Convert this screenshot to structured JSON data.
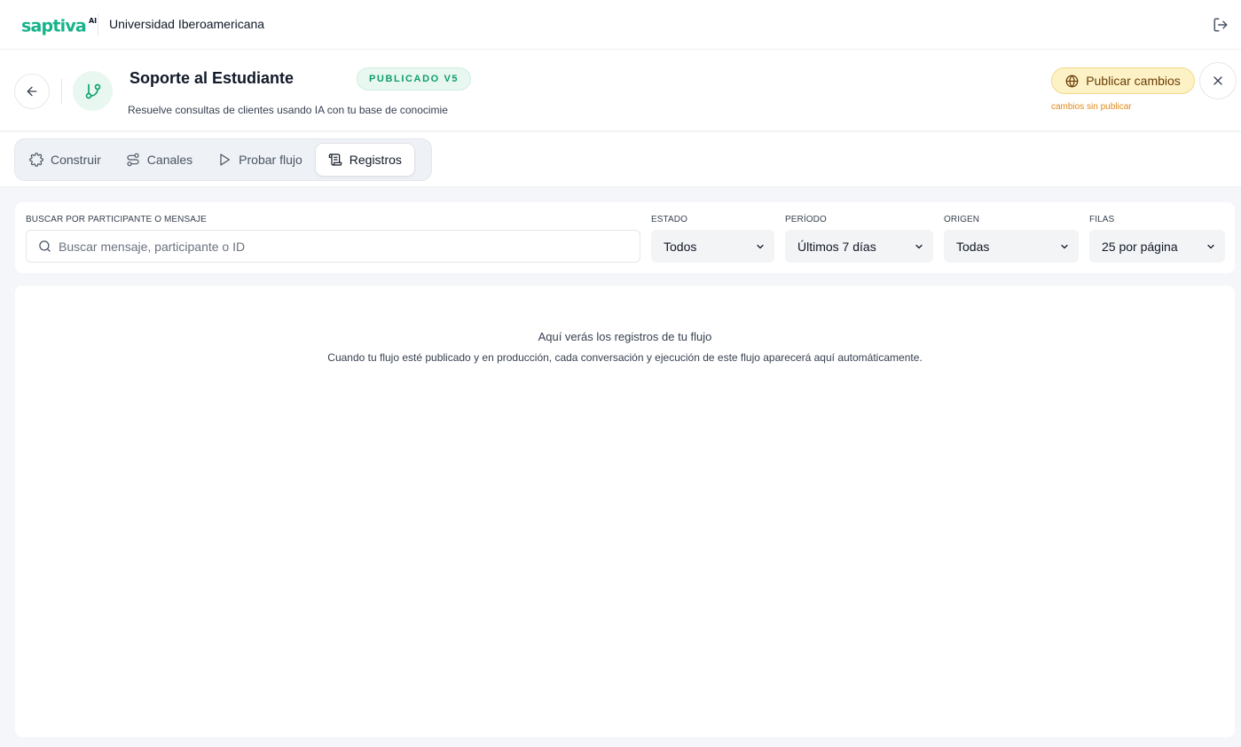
{
  "topbar": {
    "brand": "saptiva",
    "brand_sup": "AI",
    "org_name": "Universidad Iberoamericana",
    "icons": {
      "logout": "logout-icon"
    }
  },
  "header": {
    "title": "Soporte al Estudiante",
    "status": "PUBLICADO V5",
    "description": "Resuelve consultas de clientes usando IA con tu base de conocimie",
    "publish_label": "Publicar cambios",
    "unpublished_note": "cambios sin publicar",
    "icons": {
      "back": "arrow-left-icon",
      "flow": "git-branch-icon",
      "publish": "globe-icon",
      "close": "close-icon"
    },
    "colors": {
      "accent": "#10a071",
      "publish_bg": "#fdf2c6",
      "note": "#e1891a"
    }
  },
  "tabs": [
    {
      "label": "Construir",
      "icon": "puzzle-icon",
      "active": false
    },
    {
      "label": "Canales",
      "icon": "route-icon",
      "active": false
    },
    {
      "label": "Probar flujo",
      "icon": "play-icon",
      "active": false
    },
    {
      "label": "Registros",
      "icon": "scroll-icon",
      "active": true
    }
  ],
  "filters": {
    "search": {
      "label": "BUSCAR POR PARTICIPANTE O MENSAJE",
      "placeholder": "Buscar mensaje, participante o ID",
      "value": ""
    },
    "estado": {
      "label": "ESTADO",
      "value": "Todos"
    },
    "periodo": {
      "label": "PERÍODO",
      "value": "Últimos 7 días"
    },
    "origen": {
      "label": "ORIGEN",
      "value": "Todas"
    },
    "filas": {
      "label": "FILAS",
      "value": "25 por página"
    }
  },
  "empty_state": {
    "title": "Aquí verás los registros de tu flujo",
    "subtitle": "Cuando tu flujo esté publicado y en producción, cada conversación y ejecución de este flujo aparecerá aquí automáticamente."
  }
}
